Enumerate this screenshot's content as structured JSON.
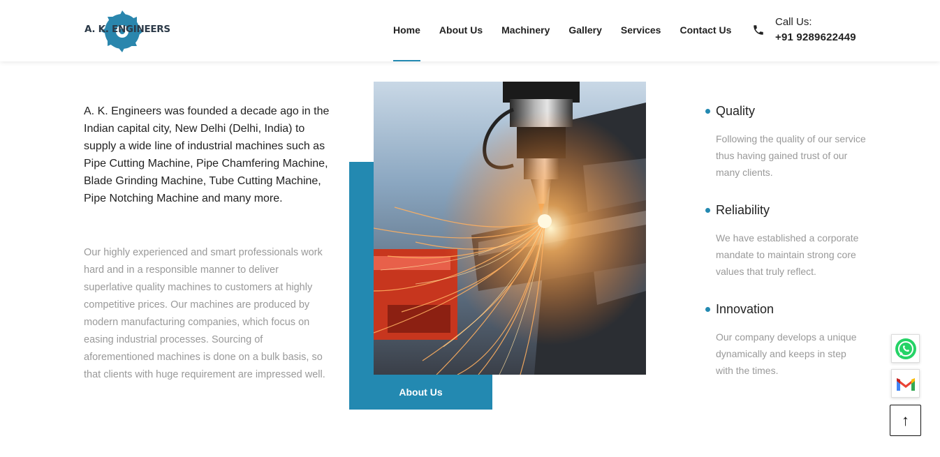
{
  "header": {
    "logo_text": "A. K. ENGINEERS",
    "nav": [
      {
        "label": "Home",
        "active": true
      },
      {
        "label": "About Us"
      },
      {
        "label": "Machinery"
      },
      {
        "label": "Gallery"
      },
      {
        "label": "Services"
      },
      {
        "label": "Contact Us"
      }
    ],
    "call_label": "Call Us:",
    "call_number": "+91 9289622449"
  },
  "intro": {
    "lead": "A. K. Engineers was founded a decade ago in the Indian capital city, New Delhi (Delhi, India) to supply a wide line of industrial machines such as Pipe Cutting Machine, Pipe Chamfering Machine, Blade Grinding Machine, Tube Cutting Machine, Pipe Notching Machine and many more.",
    "body": "Our highly experienced and smart professionals work hard and in a responsible manner to deliver superlative quality machines to customers at highly competitive prices. Our machines are produced by modern manufacturing companies, which focus on easing industrial processes. Sourcing of aforementioned machines is done on a bulk basis, so that clients with huge requirement are impressed well."
  },
  "image_block": {
    "button_label": "About Us"
  },
  "features": [
    {
      "title": "Quality",
      "desc": "Following the quality of our service thus having gained trust of our many clients."
    },
    {
      "title": "Reliability",
      "desc": "We have established a corporate mandate to maintain strong core values that truly reflect."
    },
    {
      "title": "Innovation",
      "desc": "Our company develops a unique dynamically and keeps in step with the times."
    }
  ],
  "floating": {
    "back_to_top_glyph": "↑"
  },
  "colors": {
    "accent": "#2389b1",
    "text_dark": "#222222",
    "text_muted": "#999999",
    "whatsapp": "#25d366"
  }
}
